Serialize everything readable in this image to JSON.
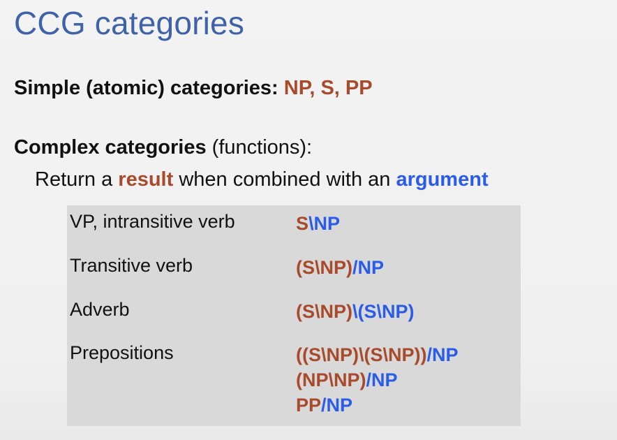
{
  "title": "CCG categories",
  "simple": {
    "label": "Simple (atomic) categories: ",
    "values": "NP, S, PP"
  },
  "complex": {
    "label": "Complex categories",
    "suffix": " (functions):"
  },
  "return_line": {
    "t1": "Return a ",
    "result": "result",
    "t2": " when combined with an ",
    "argument": "argument"
  },
  "rows": [
    {
      "label": "VP, intransitive verb",
      "lines": [
        [
          [
            "red",
            "S"
          ],
          [
            "blue",
            "\\NP"
          ]
        ]
      ]
    },
    {
      "label": "Transitive verb",
      "lines": [
        [
          [
            "red",
            "(S\\NP)"
          ],
          [
            "blue",
            "/NP"
          ]
        ]
      ]
    },
    {
      "label": "Adverb",
      "lines": [
        [
          [
            "red",
            "(S\\NP)"
          ],
          [
            "blue",
            "\\(S\\NP)"
          ]
        ]
      ]
    },
    {
      "label": "Prepositions",
      "lines": [
        [
          [
            "red",
            "((S\\NP)\\(S\\NP))"
          ],
          [
            "blue",
            "/NP"
          ]
        ],
        [
          [
            "red",
            "(NP\\NP)"
          ],
          [
            "blue",
            "/NP"
          ]
        ],
        [
          [
            "red",
            "PP"
          ],
          [
            "blue",
            "/NP"
          ]
        ]
      ]
    }
  ],
  "colors": {
    "title": "#3f62a8",
    "result": "#a84a2c",
    "argument": "#2a5ce8",
    "table_bg": "#d9d9d9"
  }
}
